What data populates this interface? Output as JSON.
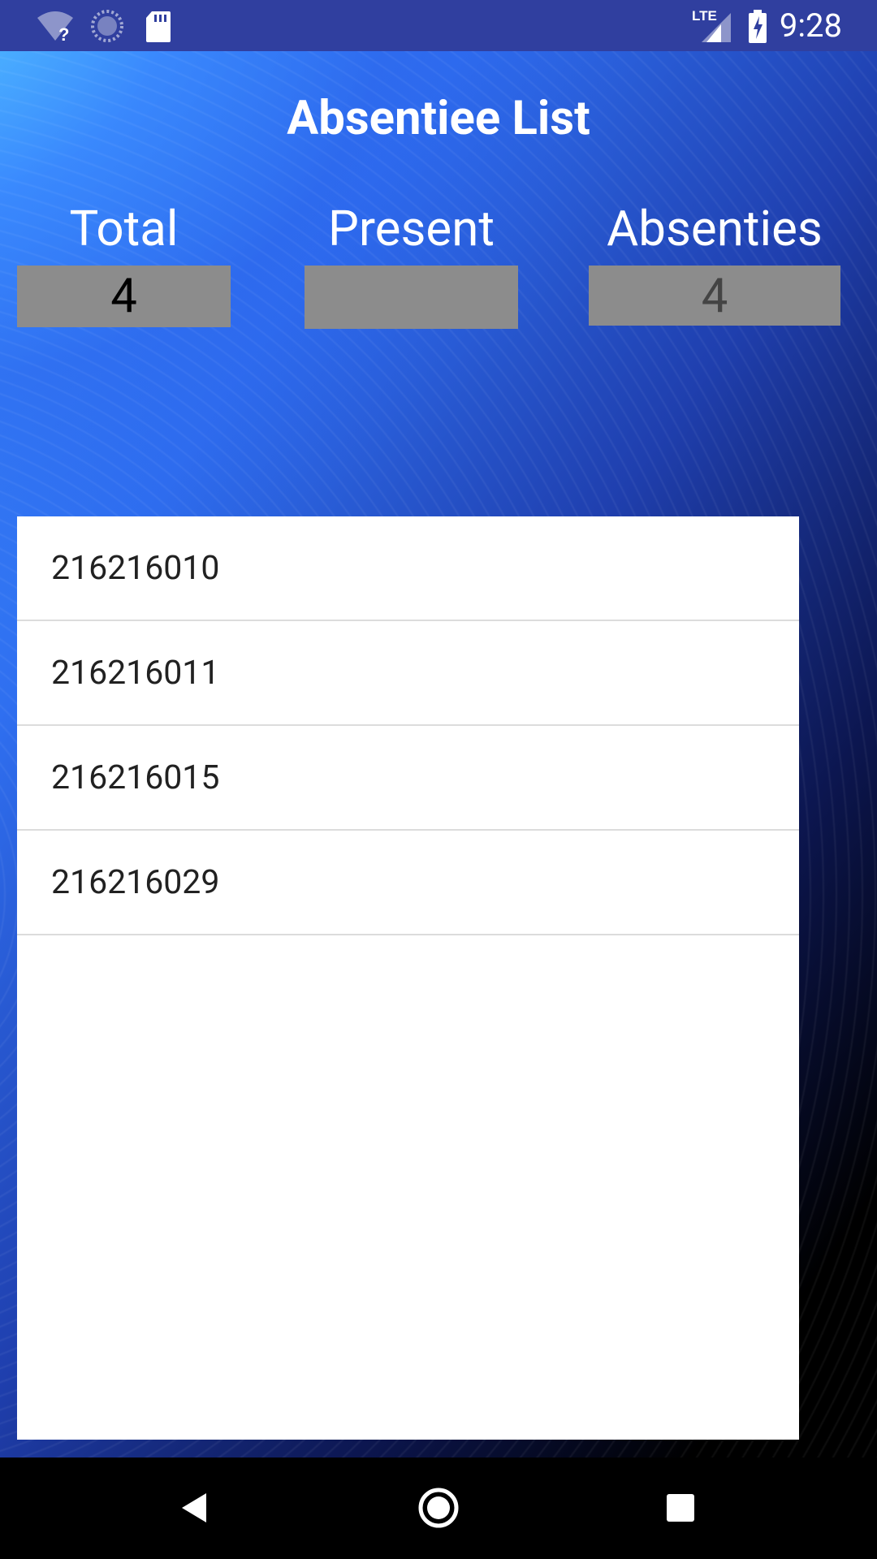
{
  "status_bar": {
    "time": "9:28",
    "network_label": "LTE",
    "icons": [
      "wifi-unknown-icon",
      "sync-icon",
      "sd-card-icon",
      "lte-signal-icon",
      "battery-charging-icon"
    ]
  },
  "screen": {
    "title": "Absentiee List"
  },
  "stats": {
    "total_label": "Total",
    "total_value": "4",
    "present_label": "Present",
    "present_value": "",
    "absent_label": "Absenties",
    "absent_value": "4"
  },
  "absentees": [
    "216216010",
    "216216011",
    "216216015",
    "216216029"
  ],
  "colors": {
    "status_bar": "#303f9f",
    "stat_box": "#8c8c8c",
    "list_bg": "#ffffff"
  },
  "nav": {
    "icons": [
      "back-icon",
      "home-icon",
      "recents-icon"
    ]
  }
}
